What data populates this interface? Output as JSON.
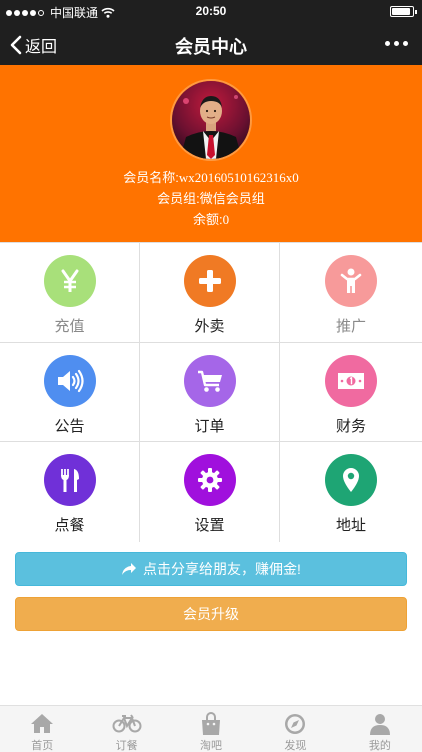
{
  "status_bar": {
    "carrier": "中国联通",
    "time": "20:50",
    "battery_level": 0.9
  },
  "nav": {
    "back_label": "返回",
    "title": "会员中心"
  },
  "profile": {
    "name_label": "会员名称:",
    "name_value": "wx20160510162316x0",
    "group_label": "会员组:",
    "group_value": "微信会员组",
    "balance_label": "余额:",
    "balance_value": "0"
  },
  "menu": [
    {
      "label": "充值",
      "icon": "yen-icon",
      "color": "#a8e07a",
      "muted": true
    },
    {
      "label": "外卖",
      "icon": "plus-icon",
      "color": "#f07a24",
      "muted": false
    },
    {
      "label": "推广",
      "icon": "child-icon",
      "color": "#f79a9a",
      "muted": true
    },
    {
      "label": "公告",
      "icon": "volume-icon",
      "color": "#4f8ef0",
      "muted": false
    },
    {
      "label": "订单",
      "icon": "cart-icon",
      "color": "#a566e8",
      "muted": false
    },
    {
      "label": "财务",
      "icon": "money-icon",
      "color": "#f06aa0",
      "muted": false
    },
    {
      "label": "点餐",
      "icon": "cutlery-icon",
      "color": "#7030d8",
      "muted": false
    },
    {
      "label": "设置",
      "icon": "gear-icon",
      "color": "#a010dd",
      "muted": false
    },
    {
      "label": "地址",
      "icon": "map-marker-icon",
      "color": "#1ea574",
      "muted": false
    }
  ],
  "buttons": {
    "share_label": "点击分享给朋友，赚佣金!",
    "upgrade_label": "会员升级"
  },
  "tabs": [
    {
      "label": "首页",
      "icon": "home-icon"
    },
    {
      "label": "订餐",
      "icon": "bicycle-icon"
    },
    {
      "label": "淘吧",
      "icon": "shopping-bag-icon"
    },
    {
      "label": "发现",
      "icon": "compass-icon"
    },
    {
      "label": "我的",
      "icon": "user-icon"
    }
  ],
  "colors": {
    "header": "#1f1f1f",
    "profile_bg": "#ff7300",
    "share": "#5bc0de",
    "upgrade": "#f0ad4e"
  }
}
